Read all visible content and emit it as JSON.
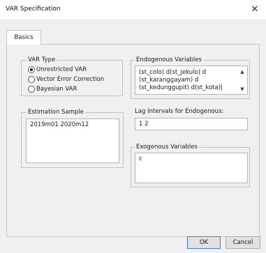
{
  "window": {
    "title": "VAR Specification",
    "close_glyph": "✕"
  },
  "tabs": [
    {
      "label": "Basics",
      "selected": true
    }
  ],
  "var_type": {
    "label": "VAR Type",
    "options": [
      {
        "label": "Unrestricted VAR",
        "selected": true
      },
      {
        "label": "Vector Error Correction",
        "selected": false
      },
      {
        "label": "Bayesian VAR",
        "selected": false
      }
    ]
  },
  "estimation_sample": {
    "label": "Estimation Sample",
    "value": "2019m01 2020m12"
  },
  "endogenous": {
    "label": "Endogenous Variables",
    "lines": [
      "(st_colo) d(st_jekulo) d",
      "(st_karanggayam) d",
      "(st_kedunggupit) d(st_kota)|"
    ]
  },
  "lag_intervals": {
    "label": "Lag Intervals for Endogenous:",
    "value": "1 2"
  },
  "exogenous": {
    "label": "Exogenous Variables",
    "value": "c"
  },
  "buttons": {
    "ok": "OK",
    "cancel": "Cancel"
  },
  "icons": {
    "scroll_up": "▲",
    "scroll_down": "▼"
  }
}
